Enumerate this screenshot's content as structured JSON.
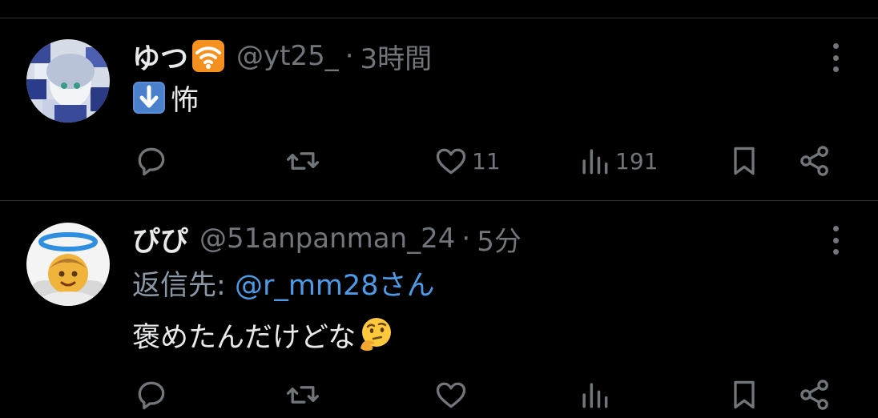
{
  "tweets": [
    {
      "name": "ゆつ",
      "name_emoji": "wifi-signal-emoji",
      "handle": "@yt25_",
      "separator": "·",
      "time": "3時間",
      "body": "怖",
      "body_emoji": "down-arrow-emoji",
      "replies": "",
      "retweets": "",
      "likes": "11",
      "views": "191"
    },
    {
      "name": "ぴぴ",
      "handle": "@51anpanman_24",
      "separator": "·",
      "time": "5分",
      "reply_prefix": "返信先:",
      "reply_to": "@r_mm28さん",
      "body": "褒めたんだけどな",
      "body_emoji": "thinking-face-emoji",
      "replies": "",
      "retweets": "",
      "likes": "",
      "views": ""
    }
  ],
  "colors": {
    "background": "#000000",
    "text": "#e7e9ea",
    "secondary": "#71767b",
    "mention": "#4c9be8",
    "divider": "#2f3336"
  },
  "icons": [
    "reply-icon",
    "retweet-icon",
    "like-icon",
    "views-icon",
    "bookmark-icon",
    "share-icon",
    "more-icon"
  ]
}
